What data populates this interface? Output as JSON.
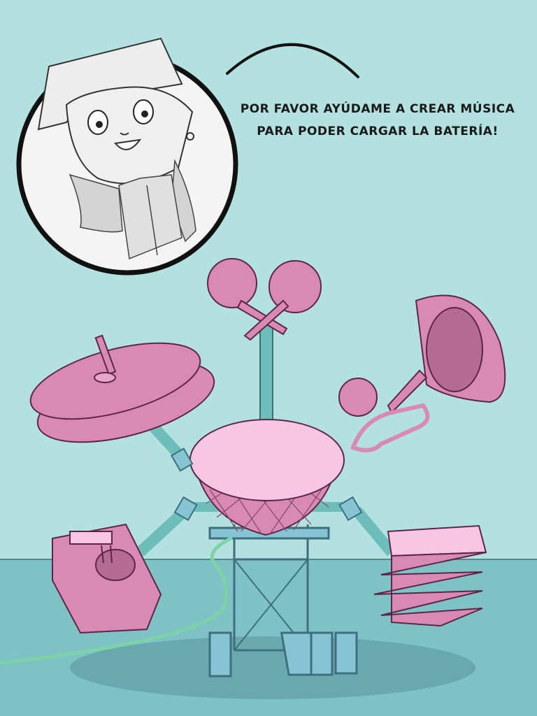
{
  "dialogue": {
    "line1": "POR FAVOR AYÚDAME A CREAR MÚSICA",
    "line2": "PARA PODER CARGAR LA BATERÍA!"
  },
  "colors": {
    "wall": "#b3e1df",
    "floor": "#7ec2c6",
    "pink": "#d98ab4",
    "pink_light": "#f6c6e3",
    "teal_pipe": "#6dbdbb",
    "stand_blue": "#86c3d3"
  }
}
